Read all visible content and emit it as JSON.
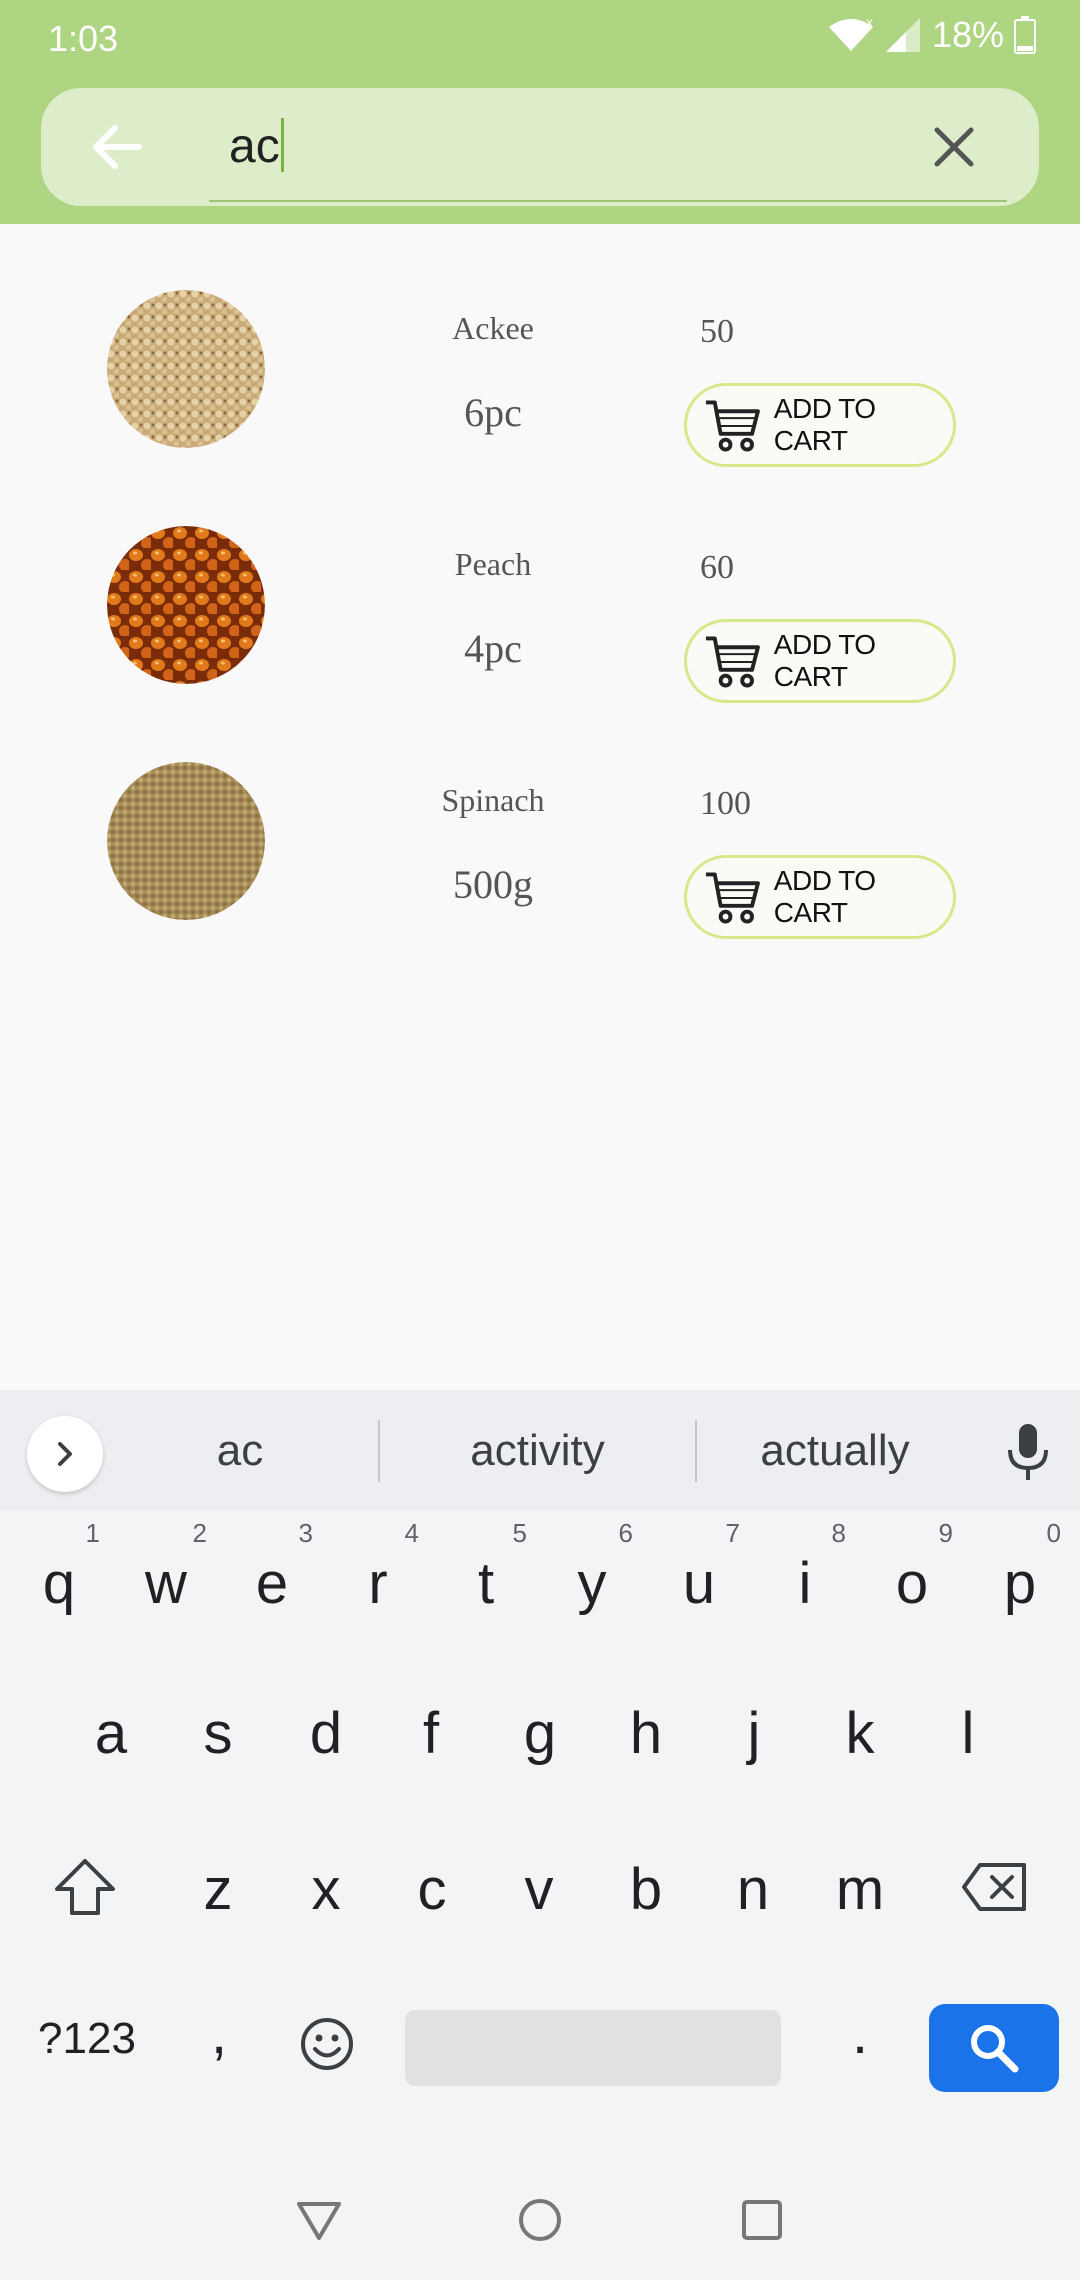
{
  "status": {
    "time": "1:03",
    "battery": "18%"
  },
  "search": {
    "query": "ac"
  },
  "products": [
    {
      "name": "Ackee",
      "qty": "6pc",
      "price": "50",
      "cart_label": "ADD TO CART",
      "thumb": "millet"
    },
    {
      "name": "Peach",
      "qty": "4pc",
      "price": "60",
      "cart_label": "ADD TO CART",
      "thumb": "corn"
    },
    {
      "name": "Spinach",
      "qty": "500g",
      "price": "100",
      "cart_label": "ADD TO CART",
      "thumb": "seed"
    }
  ],
  "keyboard": {
    "suggestions": [
      "ac",
      "activity",
      "actually"
    ],
    "row1": [
      "q",
      "w",
      "e",
      "r",
      "t",
      "y",
      "u",
      "i",
      "o",
      "p"
    ],
    "row1_hints": [
      "1",
      "2",
      "3",
      "4",
      "5",
      "6",
      "7",
      "8",
      "9",
      "0"
    ],
    "row2": [
      "a",
      "s",
      "d",
      "f",
      "g",
      "h",
      "j",
      "k",
      "l"
    ],
    "row3": [
      "z",
      "x",
      "c",
      "v",
      "b",
      "n",
      "m"
    ],
    "symbols_label": "?123",
    "comma": ",",
    "period": "."
  },
  "colors": {
    "topbar": "#aed581",
    "search_bg": "#deedc9",
    "button_border": "#d6e98a",
    "search_key": "#1a73e8"
  }
}
